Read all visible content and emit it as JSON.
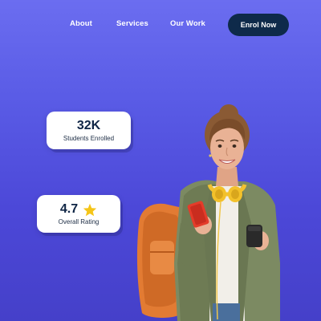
{
  "nav": {
    "links": [
      "About",
      "Services",
      "Our Work"
    ],
    "cta_label": "Enrol Now"
  },
  "stats": {
    "students": {
      "value": "32K",
      "label": "Students Enrolled"
    },
    "rating": {
      "value": "4.7",
      "label": "Overall Rating",
      "icon": "star-icon"
    }
  },
  "hero_image": {
    "icon": "student-photo"
  },
  "colors": {
    "background_top": "#6b6df0",
    "background_bottom": "#4540c9",
    "cta_background": "#0e2a4a",
    "card_background": "#ffffff",
    "text_dark": "#0f2545",
    "star": "#f5c518"
  }
}
